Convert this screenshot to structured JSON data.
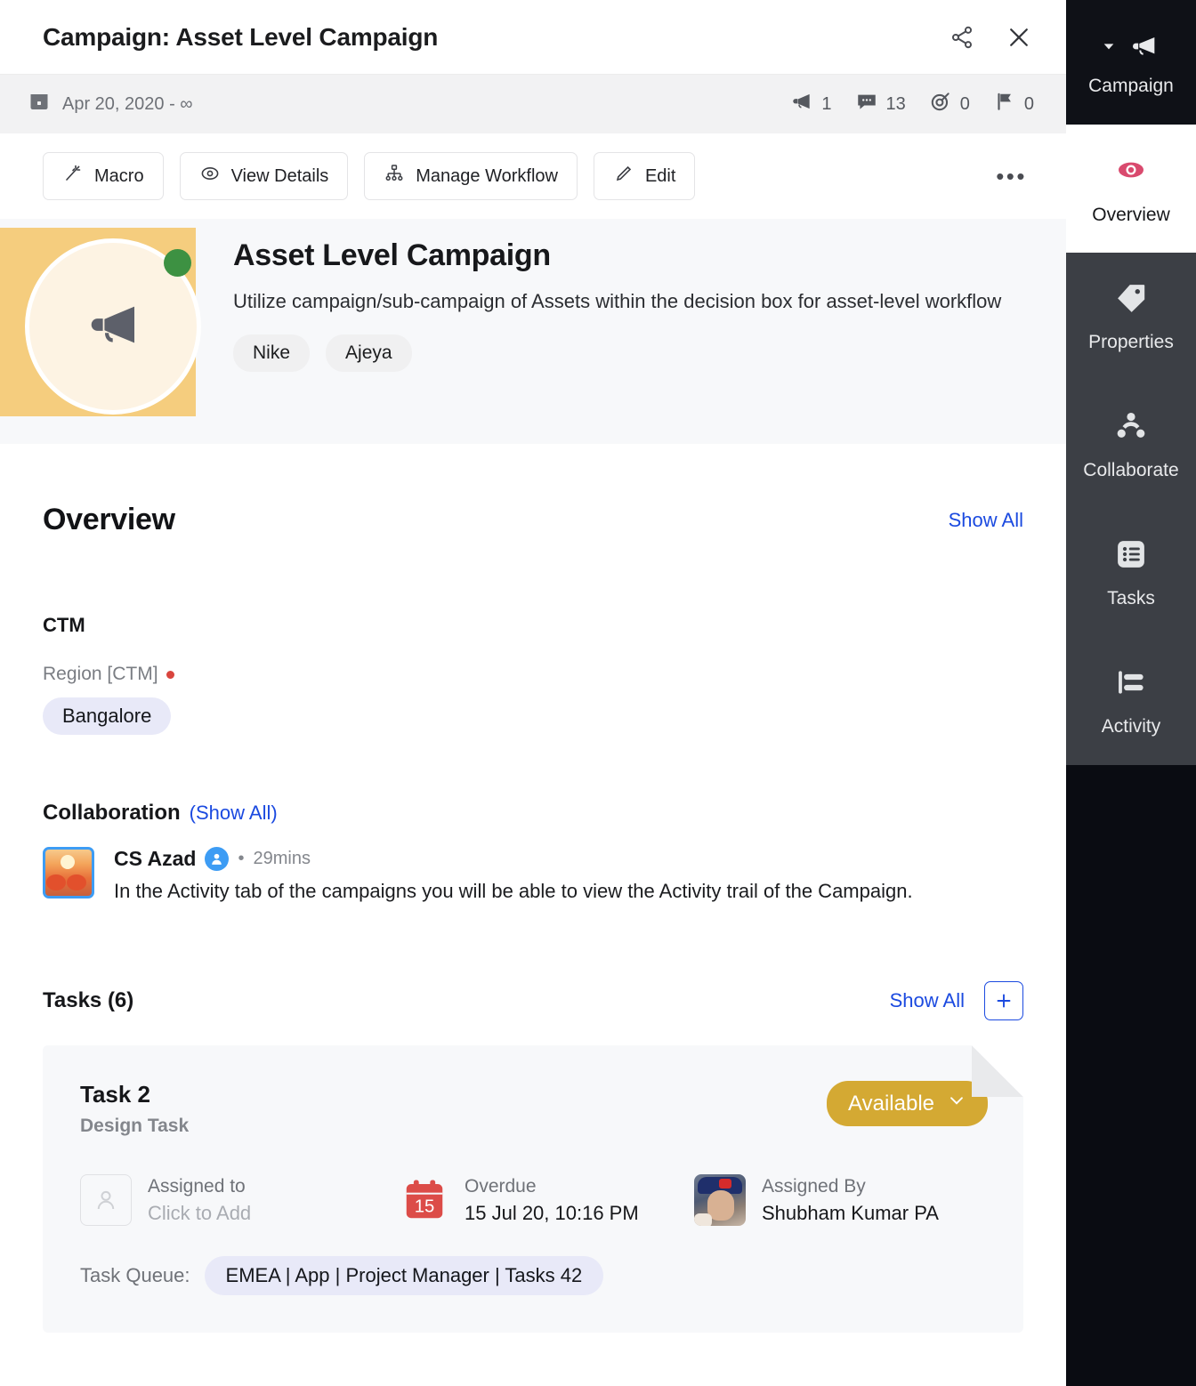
{
  "window": {
    "title": "Campaign: Asset Level Campaign",
    "share_icon": "share-icon",
    "close_icon": "close-icon"
  },
  "meta": {
    "date_range": "Apr 20, 2020 - ∞",
    "calendar_icon": "calendar-icon",
    "stats": [
      {
        "icon": "megaphone-icon",
        "value": "1"
      },
      {
        "icon": "comment-icon",
        "value": "13"
      },
      {
        "icon": "target-icon",
        "value": "0"
      },
      {
        "icon": "flag-icon",
        "value": "0"
      }
    ]
  },
  "toolbar": {
    "buttons": [
      {
        "label": "Macro",
        "icon": "magic-wand-icon"
      },
      {
        "label": "View Details",
        "icon": "eye-icon"
      },
      {
        "label": "Manage Workflow",
        "icon": "workflow-icon"
      },
      {
        "label": "Edit",
        "icon": "pencil-icon"
      }
    ],
    "overflow_label": "•••"
  },
  "hero": {
    "avatar_icon": "megaphone-icon",
    "status": "active",
    "status_color": "#3d9142",
    "band_color": "#f5cd7e",
    "title": "Asset Level Campaign",
    "description": "Utilize campaign/sub-campaign of Assets within the decision box for asset-level workflow",
    "tags": [
      "Nike",
      "Ajeya"
    ]
  },
  "overview": {
    "heading": "Overview",
    "show_all": "Show All",
    "ctm": {
      "heading": "CTM",
      "field_label": "Region [CTM]",
      "value": "Bangalore"
    },
    "collaboration": {
      "heading": "Collaboration",
      "show_all": "(Show All)",
      "item": {
        "avatar": "user-photo-avatar",
        "name": "CS Azad",
        "badge_icon": "user-badge-icon",
        "separator": "•",
        "time": "29mins",
        "text": "In the Activity tab of the campaigns you will be able to view the Activity trail of the Campaign."
      }
    },
    "tasks": {
      "heading": "Tasks (6)",
      "show_all": "Show All",
      "add_label": "+",
      "card": {
        "name": "Task 2",
        "type": "Design Task",
        "status": "Available",
        "status_color": "#d4a933",
        "status_chevron": "chevron-down-icon",
        "assigned_to_label": "Assigned to",
        "assigned_to_value": "Click to Add",
        "due_label": "Overdue",
        "due_value": "15 Jul 20, 10:16 PM",
        "due_day": "15",
        "assigned_by_label": "Assigned By",
        "assigned_by_value": "Shubham Kumar PA",
        "queue_label": "Task Queue:",
        "queue_value": "EMEA | App | Project Manager | Tasks 42"
      }
    }
  },
  "sidebar": {
    "header": {
      "label": "Campaign",
      "icon": "megaphone-icon",
      "caret": "caret-down-icon"
    },
    "items": [
      {
        "label": "Overview",
        "icon": "eye-icon",
        "active": true,
        "accent": "#d94a6e"
      },
      {
        "label": "Properties",
        "icon": "tag-icon",
        "active": false
      },
      {
        "label": "Collaborate",
        "icon": "people-icon",
        "active": false
      },
      {
        "label": "Tasks",
        "icon": "list-icon",
        "active": false
      },
      {
        "label": "Activity",
        "icon": "activity-icon",
        "active": false
      }
    ]
  }
}
